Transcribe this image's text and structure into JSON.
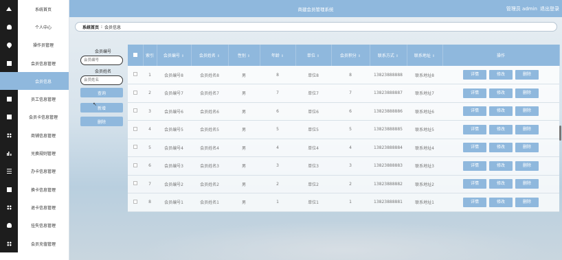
{
  "header": {
    "title": "商建会员管理系统",
    "user": "管理员 admin",
    "logout": "退出登录"
  },
  "sidebar": {
    "items": [
      {
        "label": "系统首页",
        "icon": "home-icon"
      },
      {
        "label": "个人中心",
        "icon": "person-icon"
      },
      {
        "label": "操作员管理",
        "icon": "pin-icon"
      },
      {
        "label": "会员信息管理",
        "icon": "bookmark-icon"
      },
      {
        "label": "会员信息",
        "icon": "",
        "active": true
      },
      {
        "label": "员工信息管理",
        "icon": "briefcase-icon"
      },
      {
        "label": "会员卡信息管理",
        "icon": "monitor-icon"
      },
      {
        "label": "商铺信息管理",
        "icon": "grid-icon"
      },
      {
        "label": "兑换规则管理",
        "icon": "chart-icon"
      },
      {
        "label": "办卡信息管理",
        "icon": "list-icon"
      },
      {
        "label": "换卡信息管理",
        "icon": "briefcase-icon"
      },
      {
        "label": "退卡信息管理",
        "icon": "grid-icon"
      },
      {
        "label": "挂失信息管理",
        "icon": "person-icon"
      },
      {
        "label": "会员充值管理",
        "icon": "grid-icon"
      }
    ]
  },
  "breadcrumb": {
    "home": "系统首页",
    "separator": "⁝",
    "current": "会员信息"
  },
  "filter": {
    "no_label": "会员编号",
    "no_placeholder": "会员编号",
    "name_label": "会员姓名",
    "name_placeholder": "会员姓名",
    "search_button": "查询",
    "add_button": "新增",
    "delete_button": "删除"
  },
  "table": {
    "columns": [
      "索引",
      "会员编号",
      "会员姓名",
      "性别",
      "年龄",
      "单位",
      "会员积分",
      "联系方式",
      "联系地址",
      "操作"
    ],
    "sortable": [
      "⇕"
    ],
    "actions": {
      "detail": "详情",
      "edit": "修改",
      "delete": "删除"
    },
    "rows": [
      {
        "index": "1",
        "no": "会员编号8",
        "name": "会员姓名8",
        "gender": "男",
        "age": "8",
        "unit": "单位8",
        "points": "8",
        "phone": "13823888888",
        "address": "联系地址8"
      },
      {
        "index": "2",
        "no": "会员编号7",
        "name": "会员姓名7",
        "gender": "男",
        "age": "7",
        "unit": "单位7",
        "points": "7",
        "phone": "13823888887",
        "address": "联系地址7"
      },
      {
        "index": "3",
        "no": "会员编号6",
        "name": "会员姓名6",
        "gender": "男",
        "age": "6",
        "unit": "单位6",
        "points": "6",
        "phone": "13823888886",
        "address": "联系地址6"
      },
      {
        "index": "4",
        "no": "会员编号5",
        "name": "会员姓名5",
        "gender": "男",
        "age": "5",
        "unit": "单位5",
        "points": "5",
        "phone": "13823888885",
        "address": "联系地址5"
      },
      {
        "index": "5",
        "no": "会员编号4",
        "name": "会员姓名4",
        "gender": "男",
        "age": "4",
        "unit": "单位4",
        "points": "4",
        "phone": "13823888884",
        "address": "联系地址4"
      },
      {
        "index": "6",
        "no": "会员编号3",
        "name": "会员姓名3",
        "gender": "男",
        "age": "3",
        "unit": "单位3",
        "points": "3",
        "phone": "13823888883",
        "address": "联系地址3"
      },
      {
        "index": "7",
        "no": "会员编号2",
        "name": "会员姓名2",
        "gender": "男",
        "age": "2",
        "unit": "单位2",
        "points": "2",
        "phone": "13823888882",
        "address": "联系地址2"
      },
      {
        "index": "8",
        "no": "会员编号1",
        "name": "会员姓名1",
        "gender": "男",
        "age": "1",
        "unit": "单位1",
        "points": "1",
        "phone": "13823888881",
        "address": "联系地址1"
      }
    ]
  },
  "colors": {
    "accent": "#8fb8dd",
    "sidebar_icon_bg": "#1d1d1d"
  }
}
